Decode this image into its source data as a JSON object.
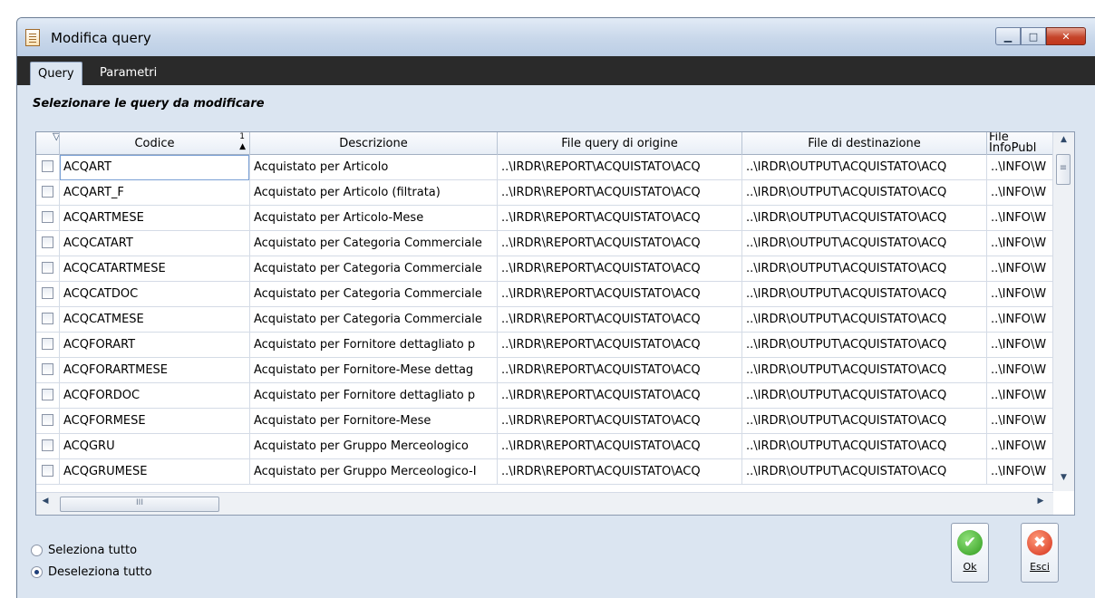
{
  "window": {
    "title": "Modifica query"
  },
  "tabs": [
    {
      "label": "Query"
    },
    {
      "label": "Parametri"
    }
  ],
  "heading": "Selezionare le query da modificare",
  "grid": {
    "headers": {
      "codice": "Codice",
      "sort_index": "1",
      "descrizione": "Descrizione",
      "file_origine": "File query di origine",
      "file_destinazione": "File di destinazione",
      "file_info": "File\nInfoPubl"
    },
    "rows": [
      {
        "codice": "ACQART",
        "descrizione": "Acquistato per Articolo",
        "origine": "..\\IRDR\\REPORT\\ACQUISTATO\\ACQ",
        "destinazione": "..\\IRDR\\OUTPUT\\ACQUISTATO\\ACQ",
        "info": "..\\INFO\\W"
      },
      {
        "codice": "ACQART_F",
        "descrizione": "Acquistato per Articolo (filtrata)",
        "origine": "..\\IRDR\\REPORT\\ACQUISTATO\\ACQ",
        "destinazione": "..\\IRDR\\OUTPUT\\ACQUISTATO\\ACQ",
        "info": "..\\INFO\\W"
      },
      {
        "codice": "ACQARTMESE",
        "descrizione": "Acquistato per Articolo-Mese",
        "origine": "..\\IRDR\\REPORT\\ACQUISTATO\\ACQ",
        "destinazione": "..\\IRDR\\OUTPUT\\ACQUISTATO\\ACQ",
        "info": "..\\INFO\\W"
      },
      {
        "codice": "ACQCATART",
        "descrizione": "Acquistato per Categoria Commerciale",
        "origine": "..\\IRDR\\REPORT\\ACQUISTATO\\ACQ",
        "destinazione": "..\\IRDR\\OUTPUT\\ACQUISTATO\\ACQ",
        "info": "..\\INFO\\W"
      },
      {
        "codice": "ACQCATARTMESE",
        "descrizione": "Acquistato per Categoria Commerciale",
        "origine": "..\\IRDR\\REPORT\\ACQUISTATO\\ACQ",
        "destinazione": "..\\IRDR\\OUTPUT\\ACQUISTATO\\ACQ",
        "info": "..\\INFO\\W"
      },
      {
        "codice": "ACQCATDOC",
        "descrizione": "Acquistato per Categoria Commerciale",
        "origine": "..\\IRDR\\REPORT\\ACQUISTATO\\ACQ",
        "destinazione": "..\\IRDR\\OUTPUT\\ACQUISTATO\\ACQ",
        "info": "..\\INFO\\W"
      },
      {
        "codice": "ACQCATMESE",
        "descrizione": "Acquistato per Categoria Commerciale",
        "origine": "..\\IRDR\\REPORT\\ACQUISTATO\\ACQ",
        "destinazione": "..\\IRDR\\OUTPUT\\ACQUISTATO\\ACQ",
        "info": "..\\INFO\\W"
      },
      {
        "codice": "ACQFORART",
        "descrizione": "Acquistato per Fornitore dettagliato p",
        "origine": "..\\IRDR\\REPORT\\ACQUISTATO\\ACQ",
        "destinazione": "..\\IRDR\\OUTPUT\\ACQUISTATO\\ACQ",
        "info": "..\\INFO\\W"
      },
      {
        "codice": "ACQFORARTMESE",
        "descrizione": "Acquistato per Fornitore-Mese dettag",
        "origine": "..\\IRDR\\REPORT\\ACQUISTATO\\ACQ",
        "destinazione": "..\\IRDR\\OUTPUT\\ACQUISTATO\\ACQ",
        "info": "..\\INFO\\W"
      },
      {
        "codice": "ACQFORDOC",
        "descrizione": "Acquistato per Fornitore dettagliato p",
        "origine": "..\\IRDR\\REPORT\\ACQUISTATO\\ACQ",
        "destinazione": "..\\IRDR\\OUTPUT\\ACQUISTATO\\ACQ",
        "info": "..\\INFO\\W"
      },
      {
        "codice": "ACQFORMESE",
        "descrizione": "Acquistato per Fornitore-Mese",
        "origine": "..\\IRDR\\REPORT\\ACQUISTATO\\ACQ",
        "destinazione": "..\\IRDR\\OUTPUT\\ACQUISTATO\\ACQ",
        "info": "..\\INFO\\W"
      },
      {
        "codice": "ACQGRU",
        "descrizione": "Acquistato per Gruppo Merceologico",
        "origine": "..\\IRDR\\REPORT\\ACQUISTATO\\ACQ",
        "destinazione": "..\\IRDR\\OUTPUT\\ACQUISTATO\\ACQ",
        "info": "..\\INFO\\W"
      },
      {
        "codice": "ACQGRUMESE",
        "descrizione": "Acquistato per Gruppo Merceologico-I",
        "origine": "..\\IRDR\\REPORT\\ACQUISTATO\\ACQ",
        "destinazione": "..\\IRDR\\OUTPUT\\ACQUISTATO\\ACQ",
        "info": "..\\INFO\\W"
      }
    ],
    "hscroll_grip": "III",
    "vscroll_grip": "≡"
  },
  "options": {
    "select_all": "Seleziona tutto",
    "deselect_all": "Deseleziona tutto",
    "selected": "deselect_all"
  },
  "buttons": {
    "ok": "Ok",
    "esc": "Esci"
  },
  "colors": {
    "titlebar": "#c8d7ea",
    "tabbar": "#2a2a2a",
    "window_bg": "#dbe5f1",
    "ok_icon": "#2f9b1c",
    "esc_icon": "#d4301a"
  }
}
